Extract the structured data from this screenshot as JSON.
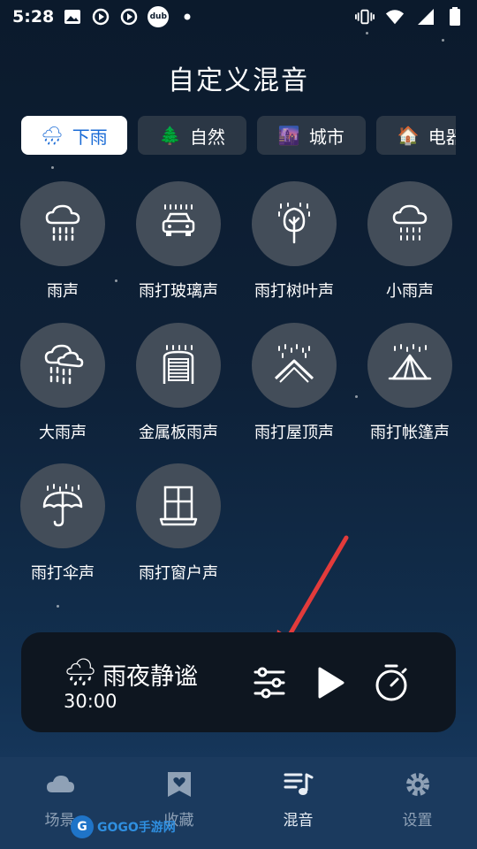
{
  "status_bar": {
    "time": "5:28",
    "left_icons": [
      "image-icon",
      "sync-icon",
      "play-circle-icon",
      "dub-icon",
      "dot-icon"
    ],
    "dub_label": "dub",
    "right_icons": [
      "vibrate-icon",
      "wifi-icon",
      "signal-icon",
      "battery-icon"
    ]
  },
  "header": {
    "title": "自定义混音"
  },
  "tabs": [
    {
      "emoji": "🌧",
      "label": "下雨",
      "active": true
    },
    {
      "emoji": "🌲",
      "label": "自然",
      "active": false
    },
    {
      "emoji": "🌆",
      "label": "城市",
      "active": false
    },
    {
      "emoji": "🏠",
      "label": "电器",
      "active": false
    }
  ],
  "sounds": [
    {
      "label": "雨声",
      "icon": "rain-cloud-icon"
    },
    {
      "label": "雨打玻璃声",
      "icon": "car-rain-icon"
    },
    {
      "label": "雨打树叶声",
      "icon": "tree-rain-icon"
    },
    {
      "label": "小雨声",
      "icon": "light-rain-icon"
    },
    {
      "label": "大雨声",
      "icon": "heavy-rain-icon"
    },
    {
      "label": "金属板雨声",
      "icon": "metal-shutter-icon"
    },
    {
      "label": "雨打屋顶声",
      "icon": "roof-rain-icon"
    },
    {
      "label": "雨打帐篷声",
      "icon": "tent-rain-icon"
    },
    {
      "label": "雨打伞声",
      "icon": "umbrella-rain-icon"
    },
    {
      "label": "雨打窗户声",
      "icon": "window-icon"
    }
  ],
  "player": {
    "emoji": "🌧",
    "name": "雨夜静谧",
    "duration": "30:00",
    "controls": [
      "mixer-sliders-icon",
      "play-icon",
      "timer-icon"
    ]
  },
  "bottom_nav": [
    {
      "label": "场景",
      "icon": "cloud-icon",
      "active": false
    },
    {
      "label": "收藏",
      "icon": "bookmark-heart-icon",
      "active": false
    },
    {
      "label": "混音",
      "icon": "music-list-icon",
      "active": true
    },
    {
      "label": "设置",
      "icon": "gear-icon",
      "active": false
    }
  ],
  "watermark": {
    "logo_text": "G",
    "text": "GOGO手游网"
  },
  "colors": {
    "active_tab_text": "#1a6bd6",
    "circle_bg": "#434d59",
    "player_bg": "#0e1620",
    "nav_bg": "#1b3a5e",
    "arrow": "#e23b3b"
  }
}
